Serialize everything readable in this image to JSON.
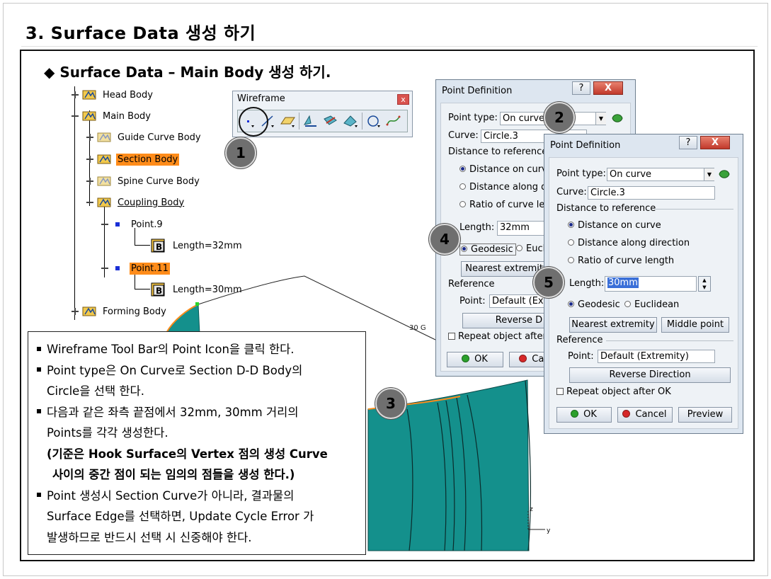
{
  "page": {
    "title": "3. Surface Data 생성 하기",
    "subtitle": "◆ Surface Data – Main Body 생성 하기."
  },
  "tree": {
    "head_body": "Head Body",
    "main_body": "Main Body",
    "guide_curve_body": "Guide Curve Body",
    "section_body": "Section Body",
    "spine_curve_body": "Spine Curve Body",
    "coupling_body": "Coupling Body",
    "point9": "Point.9",
    "length32": "Length=32mm",
    "point11": "Point.11",
    "length30": "Length=30mm",
    "forming_body": "Forming Body"
  },
  "toolbar": {
    "title": "Wireframe",
    "close": "x"
  },
  "badges": [
    "1",
    "2",
    "3",
    "4",
    "5"
  ],
  "model": {
    "label_30g": "30 G",
    "axis_z": "z",
    "axis_y": "y"
  },
  "dialog_back": {
    "title": "Point Definition",
    "help": "?",
    "close": "X",
    "point_type_label": "Point type:",
    "point_type_value": "On curve",
    "curve_label": "Curve:",
    "curve_value": "Circle.3",
    "distance_to_reference": "Distance to reference",
    "opt_distance_on_curve": "Distance on curv",
    "opt_distance_along_direction": "Distance along d",
    "opt_ratio": "Ratio of curve len",
    "length_label": "Length:",
    "length_value": "32mm",
    "geodesic": "Geodesic",
    "euclidean": "Eucli",
    "nearest_extremity": "Nearest extremity",
    "reference_section": "Reference",
    "point_label": "Point:",
    "point_value": "Default (Extr",
    "reverse_direction": "Reverse D",
    "repeat_label": "Repeat object after",
    "ok": "OK",
    "cancel": "Canc"
  },
  "dialog_front": {
    "title": "Point Definition",
    "help": "?",
    "close": "X",
    "point_type_label": "Point type:",
    "point_type_value": "On curve",
    "curve_label": "Curve:",
    "curve_value": "Circle.3",
    "distance_to_reference": "Distance to reference",
    "opt_distance_on_curve": "Distance on curve",
    "opt_distance_along_direction": "Distance along direction",
    "opt_ratio": "Ratio of curve length",
    "length_label": "Length:",
    "length_value": "30mm",
    "geodesic": "Geodesic",
    "euclidean": "Euclidean",
    "nearest_extremity": "Nearest extremity",
    "middle_point": "Middle point",
    "reference_section": "Reference",
    "point_label": "Point:",
    "point_value": "Default (Extremity)",
    "reverse_direction": "Reverse Direction",
    "repeat_label": "Repeat object after OK",
    "ok": "OK",
    "cancel": "Cancel",
    "preview": "Preview"
  },
  "info": {
    "line1": "Wireframe Tool Bar의 Point Icon을 클릭 한다.",
    "line2a": "Point type은 On Curve로 Section D-D Body의",
    "line2b": "Circle을 선택 한다.",
    "line3a": "다음과 같은 좌측 끝점에서 32mm, 30mm 거리의",
    "line3b": "Points를 각각 생성한다.",
    "line4a": "(기준은 Hook Surface의 Vertex 점의 생성 Curve",
    "line4b": "사이의 중간 점이 되는 임의의 점들을 생성 한다.)",
    "line5a": "Point 생성시 Section Curve가 아니라, 결과물의",
    "line5b": "Surface Edge를 선택하면, Update Cycle Error 가",
    "line5c": "발생하므로 반드시 선택 시 신중해야 한다."
  },
  "colors": {
    "highlight": "#ff8c1a",
    "surface_teal": "#14908c",
    "badge_gray": "#6f6f6f"
  }
}
